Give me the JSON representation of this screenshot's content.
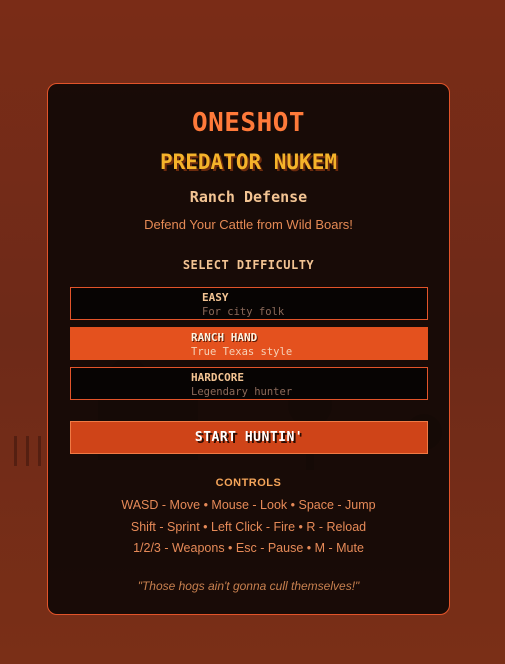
{
  "game": {
    "title_main": "ONESHOT",
    "title_sub": "PREDATOR NUKEM",
    "subtitle": "Ranch Defense",
    "tagline": "Defend Your Cattle from Wild Boars!"
  },
  "difficulty": {
    "heading": "SELECT DIFFICULTY",
    "selected": "RANCH HAND",
    "options": [
      {
        "name": "EASY",
        "desc": "For city folk"
      },
      {
        "name": "RANCH HAND",
        "desc": "True Texas style"
      },
      {
        "name": "HARDCORE",
        "desc": "Legendary hunter"
      }
    ]
  },
  "start": {
    "label": "START HUNTIN'"
  },
  "controls": {
    "heading": "CONTROLS",
    "lines": [
      "WASD - Move • Mouse - Look • Space - Jump",
      "Shift - Sprint • Left Click - Fire • R - Reload",
      "1/2/3 - Weapons • Esc - Pause • M - Mute"
    ]
  },
  "quote": "\"Those hogs ain't gonna cull themselves!\"",
  "colors": {
    "accent": "#e4511e",
    "title_orange": "#ff7a3a",
    "title_gold": "#f5b32a",
    "panel_bg": "#0e0806",
    "page_bg": "#7a2c17"
  }
}
